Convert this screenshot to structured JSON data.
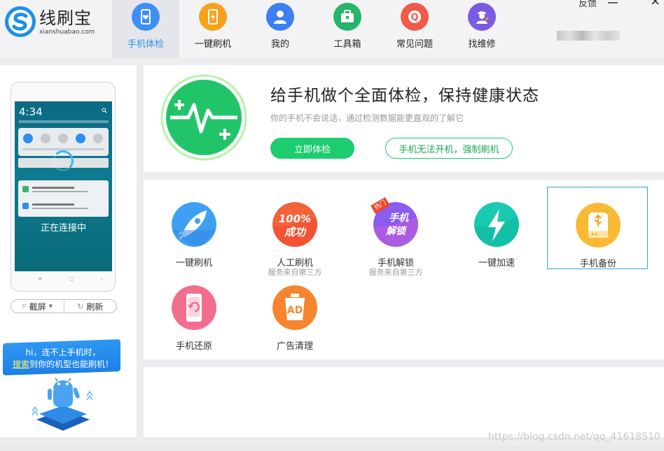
{
  "app": {
    "name": "线刷宝",
    "domain": "xianshuabao.com"
  },
  "nav": {
    "items": [
      {
        "label": "手机体检",
        "icon": "phone-heart-icon",
        "color": "#3d8ff5"
      },
      {
        "label": "一键刷机",
        "icon": "phone-flash-icon",
        "color": "#f7a21b"
      },
      {
        "label": "我的",
        "icon": "user-icon",
        "color": "#3c7ff2"
      },
      {
        "label": "工具箱",
        "icon": "toolbox-icon",
        "color": "#25b56a"
      },
      {
        "label": "常见问题",
        "icon": "question-icon",
        "color": "#f05a4a"
      },
      {
        "label": "找维修",
        "icon": "repairman-icon",
        "color": "#7b5be3"
      }
    ]
  },
  "window": {
    "feedback": "反馈"
  },
  "device": {
    "clock": "4:34",
    "status_text": "正在连接中"
  },
  "left": {
    "screenshot_btn": "截屏",
    "refresh_btn": "刷新",
    "banner_line1": "hi，连不上手机时，",
    "banner_link": "搜索",
    "banner_line2_rest": "到你的机型也能刷机！"
  },
  "checkup": {
    "title": "给手机做个全面体检，保持健康状态",
    "subtitle": "你的手机不会说话，通过检测数据能更直观的了解它",
    "primary_btn": "立即体检",
    "secondary_btn": "手机无法开机，强制刷机"
  },
  "tools": [
    {
      "label": "一键刷机",
      "sub": "",
      "icon": "rocket-icon"
    },
    {
      "label": "人工刷机",
      "sub": "服务来自第三方",
      "icon": "100-percent-success-icon",
      "icon_text_top": "100%",
      "icon_text_bottom": "成功"
    },
    {
      "label": "手机解锁",
      "sub": "服务来自第三方",
      "icon": "phone-unlock-icon",
      "icon_text_top": "手机",
      "icon_text_bottom": "解锁",
      "badge": "热门"
    },
    {
      "label": "一键加速",
      "sub": "",
      "icon": "lightning-icon"
    },
    {
      "label": "手机备份",
      "sub": "",
      "icon": "usb-drive-icon"
    },
    {
      "label": "手机还原",
      "sub": "",
      "icon": "phone-restore-icon"
    },
    {
      "label": "广告清理",
      "sub": "",
      "icon": "ad-clean-icon",
      "icon_text_top": "AD"
    }
  ],
  "watermark": "https://blog.csdn.net/qq_41618510"
}
